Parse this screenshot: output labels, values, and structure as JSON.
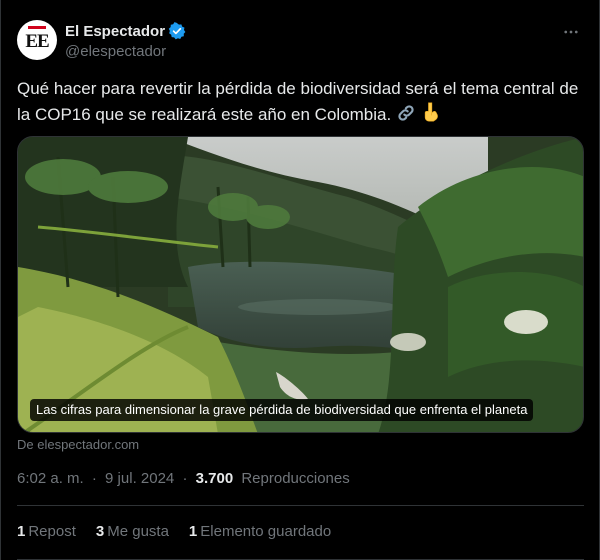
{
  "author": {
    "display_name": "El Espectador",
    "handle": "@elespectador",
    "avatar_text": "EE",
    "verified": true
  },
  "tweet": {
    "text": "Qué hacer para revertir la pérdida de biodiversidad será el tema central de la COP16 que se realizará este año en Colombia.",
    "emojis": [
      "link-icon",
      "pointing-down-icon"
    ]
  },
  "card": {
    "image_alt": "Laguna rodeada de selva y vegetación",
    "caption": "Las cifras para dimensionar la grave pérdida de biodiversidad que enfrenta el planeta",
    "source": "De elespectador.com"
  },
  "meta": {
    "time": "6:02 a. m.",
    "separator": "·",
    "date": "9 jul. 2024",
    "views_count": "3.700",
    "views_label": "Reproducciones"
  },
  "stats": {
    "reposts_count": "1",
    "reposts_label": "Repost",
    "likes_count": "3",
    "likes_label": "Me gusta",
    "bookmarks_count": "1",
    "bookmarks_label": "Elemento guardado"
  },
  "colors": {
    "background": "#000000",
    "text": "#e7e9ea",
    "secondary": "#71767b",
    "border": "#2f3336",
    "verified": "#1d9bf0"
  }
}
